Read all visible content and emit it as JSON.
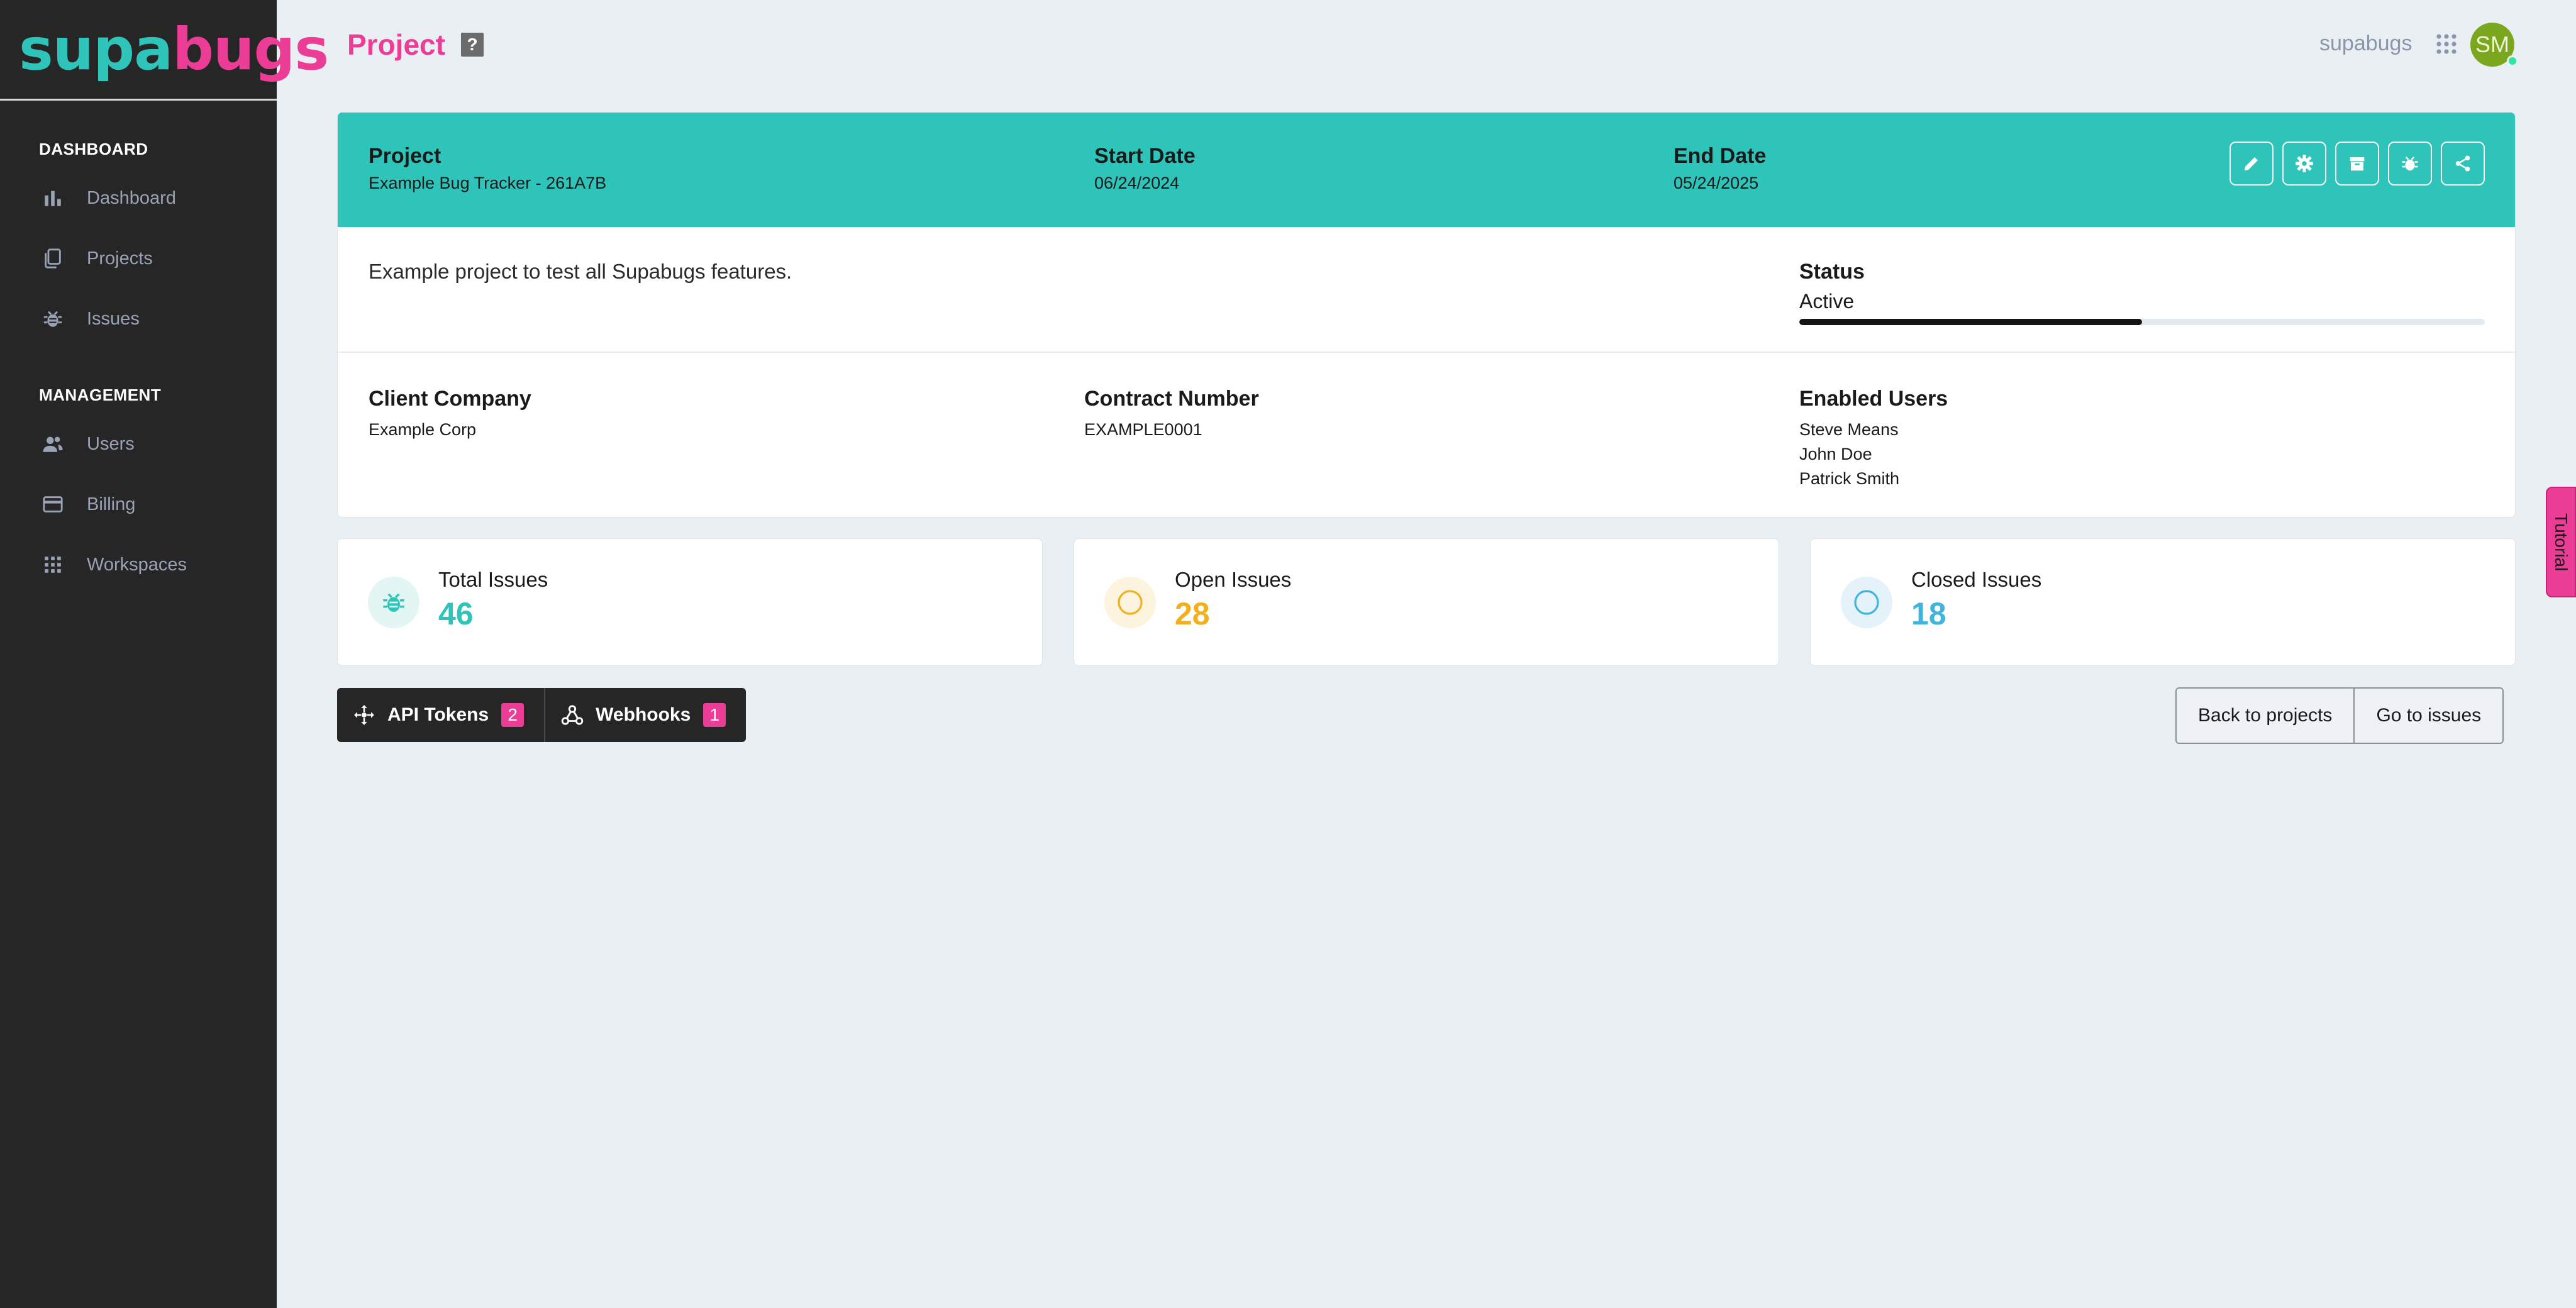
{
  "brand": {
    "part1": "supa",
    "part2": "bugs",
    "accent": "#2ec4b9",
    "pink": "#ec3d96"
  },
  "sidebar": {
    "sections": [
      {
        "title": "DASHBOARD",
        "items": [
          {
            "label": "Dashboard",
            "icon": "bar-chart-icon"
          },
          {
            "label": "Projects",
            "icon": "documents-icon"
          },
          {
            "label": "Issues",
            "icon": "bug-icon"
          }
        ]
      },
      {
        "title": "MANAGEMENT",
        "items": [
          {
            "label": "Users",
            "icon": "users-icon"
          },
          {
            "label": "Billing",
            "icon": "credit-card-icon"
          },
          {
            "label": "Workspaces",
            "icon": "grid-icon"
          }
        ]
      }
    ]
  },
  "header": {
    "title": "Project",
    "help": "?",
    "workspace": "supabugs",
    "avatar_initials": "SM"
  },
  "project": {
    "project_label": "Project",
    "project_value": "Example Bug Tracker - 261A7B",
    "start_label": "Start Date",
    "start_value": "06/24/2024",
    "end_label": "End Date",
    "end_value": "05/24/2025",
    "actions": [
      "edit-icon",
      "settings-icon",
      "archive-icon",
      "bug-icon",
      "share-icon"
    ],
    "description": "Example project to test all Supabugs features.",
    "status_label": "Status",
    "status_value": "Active",
    "status_progress": 0.5,
    "client_label": "Client Company",
    "client_value": "Example Corp",
    "contract_label": "Contract Number",
    "contract_value": "EXAMPLE0001",
    "users_label": "Enabled Users",
    "users": [
      "Steve Means",
      "John Doe",
      "Patrick Smith"
    ]
  },
  "stats": [
    {
      "label": "Total Issues",
      "value": "46",
      "color": "#2ec4b9",
      "icon": "bug-icon"
    },
    {
      "label": "Open Issues",
      "value": "28",
      "color": "#f2b01e",
      "icon": "circle-icon"
    },
    {
      "label": "Closed Issues",
      "value": "18",
      "color": "#3fb4dd",
      "icon": "circle-icon"
    }
  ],
  "toolbar": {
    "api_tokens": {
      "label": "API Tokens",
      "count": "2"
    },
    "webhooks": {
      "label": "Webhooks",
      "count": "1"
    },
    "back": "Back to projects",
    "issues": "Go to issues"
  },
  "tutorial": "Tutorial"
}
